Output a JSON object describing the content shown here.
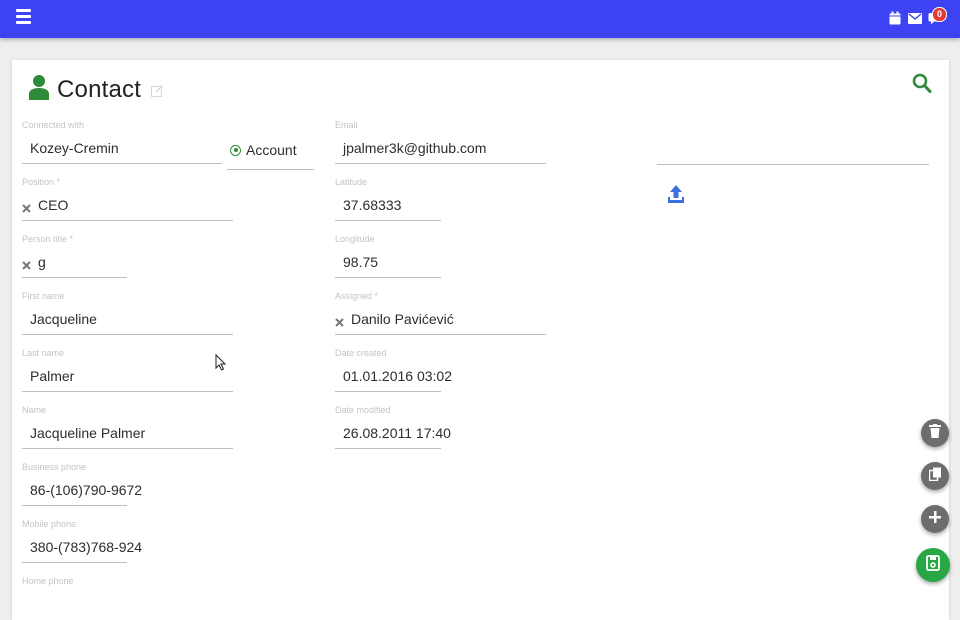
{
  "topbar": {
    "menu_icon": "hamburger-icon",
    "icons": [
      "calendar-icon",
      "mail-icon",
      "chat-icon"
    ],
    "notification_count": "0",
    "bg_color": "#3d43f2"
  },
  "card": {
    "title": "Contact",
    "title_icon": "person-icon",
    "accent_color": "#2e8b3a"
  },
  "fields": {
    "connected_with": {
      "label": "Connected with",
      "value": "Kozey-Cremin"
    },
    "account_option": {
      "label": "Account"
    },
    "position": {
      "label": "Position *",
      "value": "CEO"
    },
    "person_title": {
      "label": "Person title *",
      "value": "g"
    },
    "first_name": {
      "label": "First name",
      "value": "Jacqueline"
    },
    "last_name": {
      "label": "Last name",
      "value": "Palmer"
    },
    "name": {
      "label": "Name",
      "value": "Jacqueline Palmer"
    },
    "business_phone": {
      "label": "Business phone",
      "value": "86-(106)790-9672"
    },
    "mobile_phone": {
      "label": "Mobile phone",
      "value": "380-(783)768-924"
    },
    "home_phone": {
      "label": "Home phone",
      "value": ""
    },
    "email": {
      "label": "Email",
      "value": "jpalmer3k@github.com"
    },
    "latitude": {
      "label": "Latitude",
      "value": "37.68333"
    },
    "longitude": {
      "label": "Longitude",
      "value": "98.75"
    },
    "assigned": {
      "label": "Assigned *",
      "value": "Danilo Pavićević"
    },
    "date_created": {
      "label": "Date created",
      "value": "01.01.2016 03:02"
    },
    "date_modified": {
      "label": "Date modified",
      "value": "26.08.2011 17:40"
    }
  },
  "actions": {
    "upload_icon": "upload-icon",
    "fab_icons": [
      "trash-icon",
      "copy-icon",
      "plus-icon",
      "save-icon"
    ]
  }
}
